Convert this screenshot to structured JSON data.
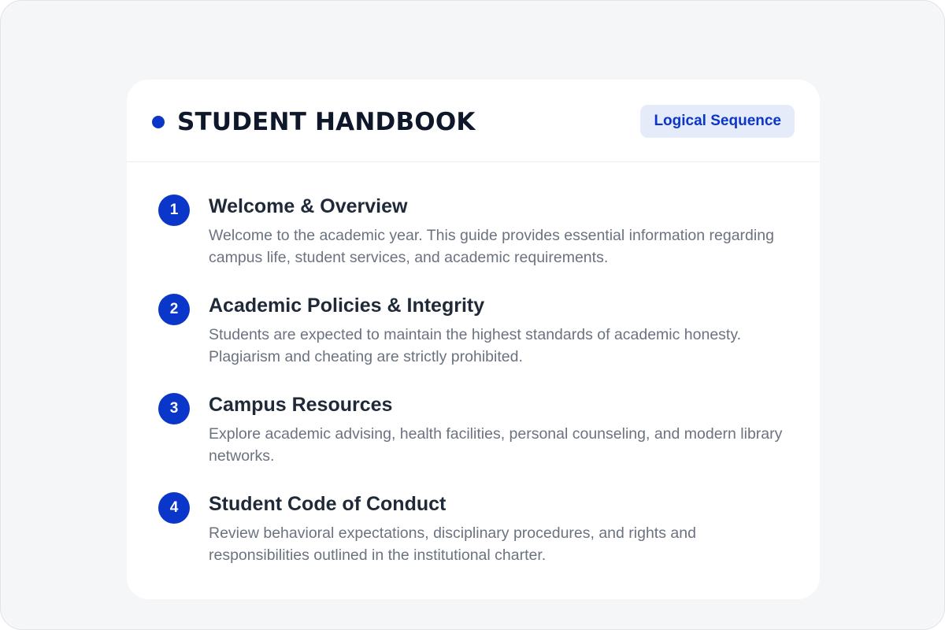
{
  "header": {
    "title": "STUDENT HANDBOOK",
    "badge": "Logical Sequence"
  },
  "steps": [
    {
      "number": "1",
      "title": "Welcome & Overview",
      "description": "Welcome to the academic year. This guide provides essential information regarding campus life, student services, and academic requirements."
    },
    {
      "number": "2",
      "title": "Academic Policies & Integrity",
      "description": "Students are expected to maintain the highest standards of academic honesty. Plagiarism and cheating are strictly prohibited."
    },
    {
      "number": "3",
      "title": "Campus Resources",
      "description": "Explore academic advising, health facilities, personal counseling, and modern library networks."
    },
    {
      "number": "4",
      "title": "Student Code of Conduct",
      "description": "Review behavioral expectations, disciplinary procedures, and rights and responsibilities outlined in the institutional charter."
    }
  ],
  "colors": {
    "accent": "#0a36c9",
    "badge_bg": "#e6ebfa",
    "title_text": "#0f172a",
    "step_title_text": "#1f2937",
    "body_text": "#6b7280",
    "page_bg": "#f5f6f8"
  },
  "icons": {
    "header_bullet": "filled-circle-dot"
  }
}
